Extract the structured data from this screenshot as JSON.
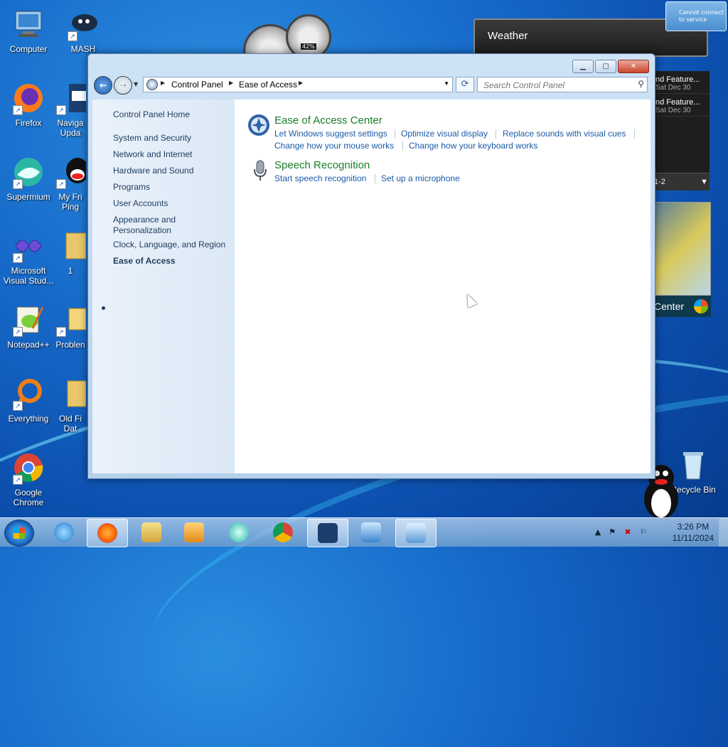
{
  "desktop": {
    "icons": [
      {
        "label": "Computer"
      },
      {
        "label": "MASH"
      },
      {
        "label": "Firefox"
      },
      {
        "label": "Naviga Upda"
      },
      {
        "label": "Supermium"
      },
      {
        "label": "My Fri Ping"
      },
      {
        "label": "Microsoft Visual Stud..."
      },
      {
        "label": "1"
      },
      {
        "label": "Notepad++"
      },
      {
        "label": "Problen"
      },
      {
        "label": "Everything"
      },
      {
        "label": "Old Fi Dat"
      },
      {
        "label": "Google Chrome"
      },
      {
        "label": "Recycle Bin"
      }
    ]
  },
  "gadgets": {
    "weather_title": "Weather",
    "feed_items": [
      {
        "title": "nd Feature...",
        "date": "Sat Dec 30"
      },
      {
        "title": "nd Feature...",
        "date": "Sat Dec 30"
      }
    ],
    "feed_page": "1-2",
    "media_center": "Center",
    "gauge_percent": "42%",
    "toast_text": "Cannot connect to service"
  },
  "window": {
    "nav": {
      "breadcrumb": [
        "Control Panel",
        "Ease of Access"
      ],
      "search_placeholder": "Search Control Panel"
    },
    "left_pane": {
      "home": "Control Panel Home",
      "items": [
        "System and Security",
        "Network and Internet",
        "Hardware and Sound",
        "Programs",
        "User Accounts",
        "Appearance and Personalization",
        "Clock, Language, and Region",
        "Ease of Access"
      ]
    },
    "categories": [
      {
        "title": "Ease of Access Center",
        "tasks": [
          "Let Windows suggest settings",
          "Optimize visual display",
          "Replace sounds with visual cues",
          "Change how your mouse works",
          "Change how your keyboard works"
        ]
      },
      {
        "title": "Speech Recognition",
        "tasks": [
          "Start speech recognition",
          "Set up a microphone"
        ]
      }
    ]
  },
  "taskbar": {
    "time": "3:26 PM",
    "date": "11/11/2024"
  }
}
